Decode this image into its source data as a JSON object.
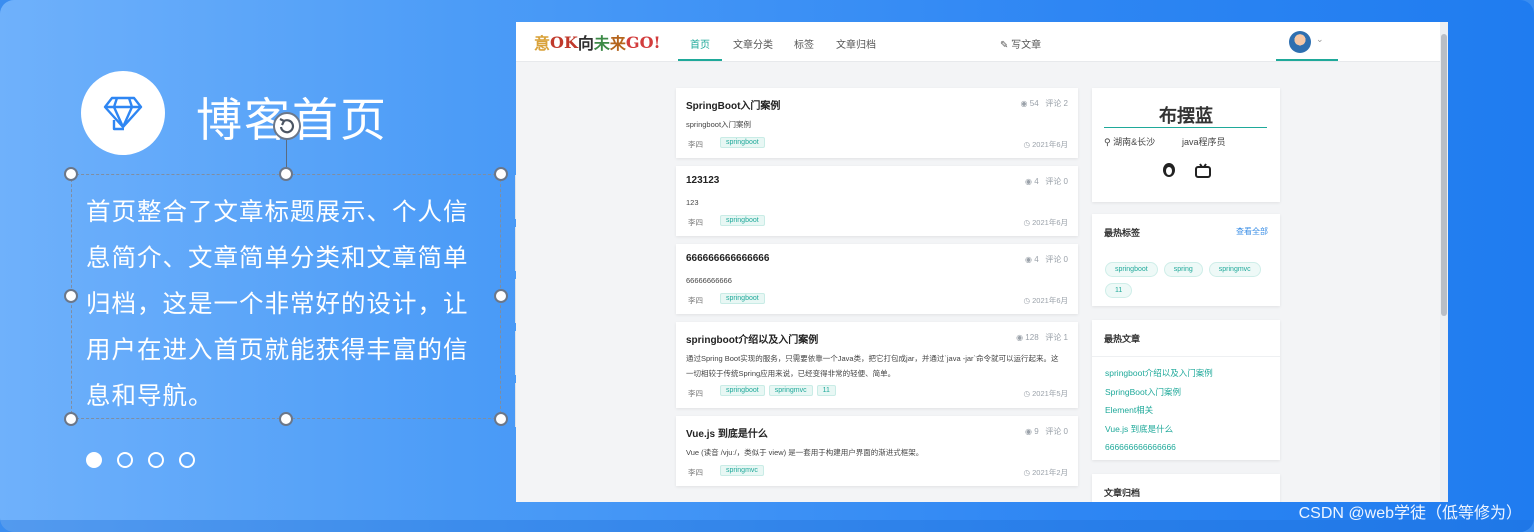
{
  "slide": {
    "title": "博客首页",
    "description": "首页整合了文章标题展示、个人信息简介、文章简单分类和文章简单归档，这是一个非常好的设计，让用户在进入首页就能获得丰富的信息和导航。",
    "carousel_dots": 4,
    "carousel_active_index": 0
  },
  "toolbar": {
    "buttons": [
      "chevrons-up-icon",
      "align-center-icon",
      "text-box-icon",
      "layer-icon",
      "resize-icon"
    ]
  },
  "blog": {
    "nav": {
      "logo_text": "意OK向未来GO!",
      "items": [
        "首页",
        "文章分类",
        "标签",
        "文章归档"
      ],
      "active_item": "首页",
      "write_label": "写文章"
    },
    "articles": [
      {
        "title": "SpringBoot入门案例",
        "views": "54",
        "comments": "评论 2",
        "summary": "springboot入门案例",
        "author": "李四",
        "tags": [
          "springboot"
        ],
        "date": "2021年6月"
      },
      {
        "title": "123123",
        "views": "4",
        "comments": "评论 0",
        "summary": "123",
        "author": "李四",
        "tags": [
          "springboot"
        ],
        "date": "2021年6月"
      },
      {
        "title": "666666666666666",
        "views": "4",
        "comments": "评论 0",
        "summary": "66666666666",
        "author": "李四",
        "tags": [
          "springboot"
        ],
        "date": "2021年6月"
      },
      {
        "title": "springboot介绍以及入门案例",
        "views": "128",
        "comments": "评论 1",
        "summary": "通过Spring Boot实现的服务，只需要依靠一个Java类，把它打包成jar，并通过`java -jar`命令就可以运行起来。这一切相较于传统Spring应用来说，已经变得非常的轻便、简单。",
        "author": "李四",
        "tags": [
          "springboot",
          "springmvc",
          "11"
        ],
        "date": "2021年5月"
      },
      {
        "title": "Vue.js 到底是什么",
        "views": "9",
        "comments": "评论 0",
        "summary": "Vue (读音 /vjuː/，类似于 view) 是一套用于构建用户界面的渐进式框架。",
        "author": "李四",
        "tags": [
          "springmvc"
        ],
        "date": "2021年2月"
      }
    ],
    "profile": {
      "name": "布摆蓝",
      "location": "湖南&长沙",
      "job": "java程序员"
    },
    "hot_tags": {
      "heading": "最热标签",
      "more": "查看全部",
      "tags": [
        "springboot",
        "spring",
        "springmvc",
        "11"
      ]
    },
    "hot_articles": {
      "heading": "最热文章",
      "items": [
        "springboot介绍以及入门案例",
        "SpringBoot入门案例",
        "Element相关",
        "Vue.js 到底是什么",
        "666666666666666"
      ]
    },
    "archive": {
      "heading": "文章归档"
    }
  },
  "watermark": "CSDN @web学徒（低等修为）",
  "colors": {
    "accent": "#1fa99a",
    "slide_blue": "#2e86f3",
    "link_blue": "#3a8ee6"
  }
}
